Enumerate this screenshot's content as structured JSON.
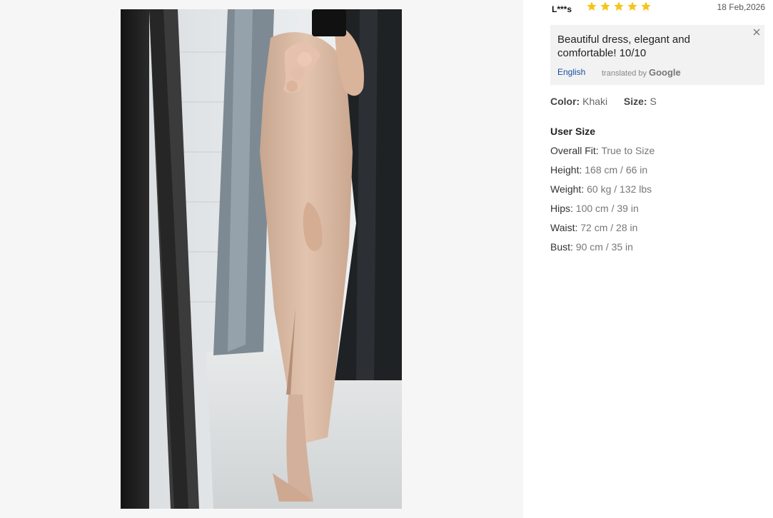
{
  "review": {
    "reviewer": "L***s",
    "rating": 5,
    "date": "18 Feb,2026",
    "star_color": "#f5c518",
    "translation": {
      "text": "Beautiful dress, elegant and comfortable! 10/10",
      "language": "English",
      "translated_by": "translated by",
      "provider": "Google"
    },
    "attributes": {
      "color_label": "Color:",
      "color_value": "Khaki",
      "size_label": "Size:",
      "size_value": "S"
    },
    "user_size": {
      "title": "User Size",
      "items": [
        {
          "label": "Overall Fit:",
          "value": "True to Size"
        },
        {
          "label": "Height:",
          "value": "168 cm / 66 in"
        },
        {
          "label": "Weight:",
          "value": "60 kg / 132 lbs"
        },
        {
          "label": "Hips:",
          "value": "100 cm / 39 in"
        },
        {
          "label": "Waist:",
          "value": "72 cm / 28 in"
        },
        {
          "label": "Bust:",
          "value": "90 cm / 35 in"
        }
      ]
    }
  },
  "icons": {
    "close": "close-icon",
    "star": "star-icon"
  }
}
